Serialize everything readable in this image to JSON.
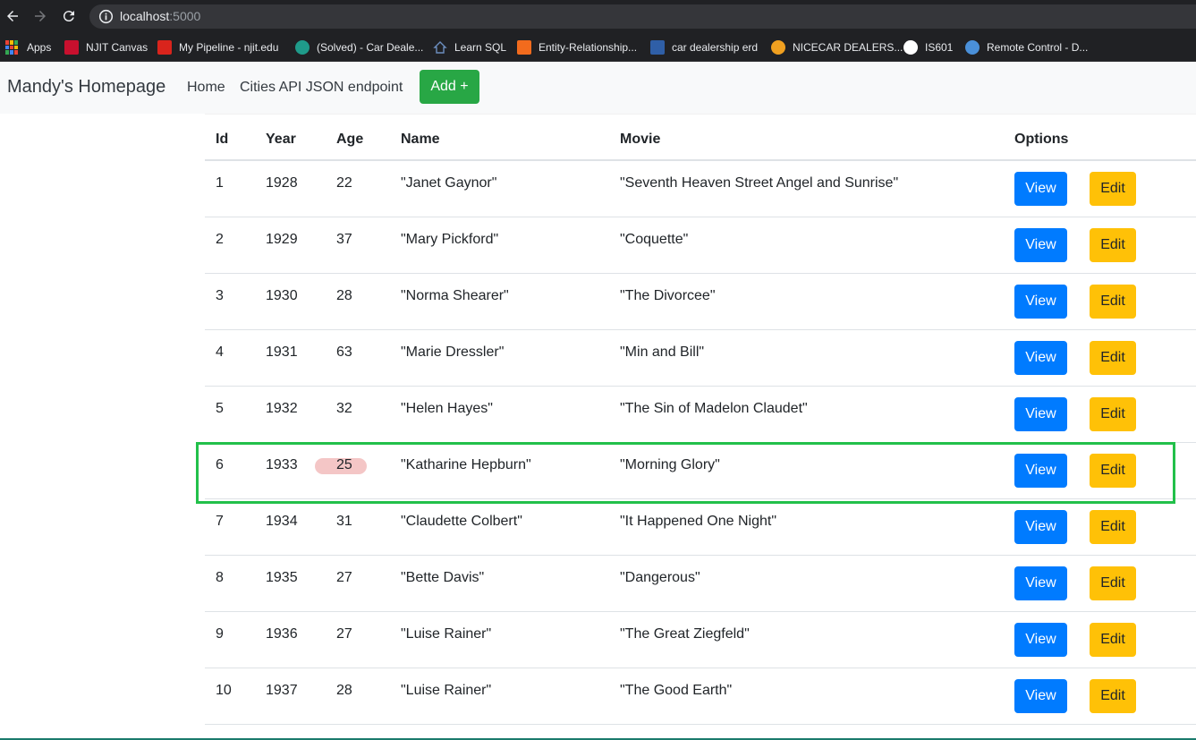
{
  "browser": {
    "url_host": "localhost",
    "url_port": ":5000",
    "bookmarks": [
      {
        "label": "Apps",
        "icon": "apps-grid-icon",
        "color": "#ea4335"
      },
      {
        "label": "NJIT Canvas",
        "icon": "njit-icon",
        "color": "#c8102e"
      },
      {
        "label": "My Pipeline - njit.edu",
        "icon": "pipeline-icon",
        "color": "#d9241c"
      },
      {
        "label": "(Solved) - Car Deale...",
        "icon": "coursehero-icon",
        "color": "#1f9b8a"
      },
      {
        "label": "Learn SQL",
        "icon": "house-icon",
        "color": "#3c6db0"
      },
      {
        "label": "Entity-Relationship...",
        "icon": "lucidchart-icon",
        "color": "#f26b1d"
      },
      {
        "label": "car dealership erd",
        "icon": "ce-icon",
        "color": "#2f5fa7"
      },
      {
        "label": "NICECAR DEALERS...",
        "icon": "nicecar-icon",
        "color": "#f0a020"
      },
      {
        "label": "IS601",
        "icon": "github-icon",
        "color": "#ffffff"
      },
      {
        "label": "Remote Control - D...",
        "icon": "remote-control-icon",
        "color": "#4a90d9"
      }
    ]
  },
  "navbar": {
    "brand": "Mandy's Homepage",
    "links": [
      "Home",
      "Cities API JSON endpoint"
    ],
    "add_button": "Add +"
  },
  "table": {
    "headers": [
      "Id",
      "Year",
      "Age",
      "Name",
      "Movie",
      "Options"
    ],
    "view_label": "View",
    "edit_label": "Edit",
    "rows": [
      {
        "id": "1",
        "year": "1928",
        "age": "22",
        "name": "\"Janet Gaynor\"",
        "movie": "\"Seventh Heaven Street Angel and Sunrise\""
      },
      {
        "id": "2",
        "year": "1929",
        "age": "37",
        "name": "\"Mary Pickford\"",
        "movie": "\"Coquette\""
      },
      {
        "id": "3",
        "year": "1930",
        "age": "28",
        "name": "\"Norma Shearer\"",
        "movie": "\"The Divorcee\""
      },
      {
        "id": "4",
        "year": "1931",
        "age": "63",
        "name": "\"Marie Dressler\"",
        "movie": "\"Min and Bill\""
      },
      {
        "id": "5",
        "year": "1932",
        "age": "32",
        "name": "\"Helen Hayes\"",
        "movie": "\"The Sin of Madelon Claudet\""
      },
      {
        "id": "6",
        "year": "1933",
        "age": "25",
        "name": "\"Katharine Hepburn\"",
        "movie": "\"Morning Glory\""
      },
      {
        "id": "7",
        "year": "1934",
        "age": "31",
        "name": "\"Claudette Colbert\"",
        "movie": "\"It Happened One Night\""
      },
      {
        "id": "8",
        "year": "1935",
        "age": "27",
        "name": "\"Bette Davis\"",
        "movie": "\"Dangerous\""
      },
      {
        "id": "9",
        "year": "1936",
        "age": "27",
        "name": "\"Luise Rainer\"",
        "movie": "\"The Great Ziegfeld\""
      },
      {
        "id": "10",
        "year": "1937",
        "age": "28",
        "name": "\"Luise Rainer\"",
        "movie": "\"The Good Earth\""
      }
    ]
  },
  "colors": {
    "view_button": "#007bff",
    "edit_button": "#ffc107",
    "add_button": "#28a745",
    "annotation": "#22c04a"
  }
}
